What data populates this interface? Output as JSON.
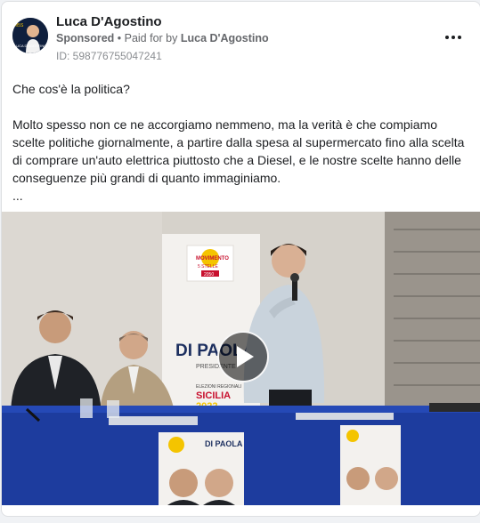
{
  "post": {
    "page_name": "Luca D'Agostino",
    "sponsored_label": "Sponsored",
    "paid_for_prefix": " • Paid for by ",
    "payer": "Luca D'Agostino",
    "library_id": "ID: 598776755047241",
    "text": {
      "line1": "Che cos'è la politica?",
      "paragraph": "Molto spesso non ce ne accorgiamo nemmeno, ma la verità è che compiamo scelte politiche giornalmente, a partire dalla spesa al supermercato fino alla scelta di comprare un'auto elettrica piuttosto che a Diesel, e le nostre scelte hanno delle conseguenze più grandi di quanto immaginiamo.",
      "ellipsis": "..."
    }
  },
  "avatar": {
    "logo_text": "M5S",
    "name_text": "LUCA D'AGOSTINO"
  },
  "video": {
    "banner_logo_line1": "MOVIMENTO",
    "banner_logo_line2": "5 STELLE",
    "banner_logo_year": "2050",
    "banner_name": "DI PAOLA",
    "banner_role": "PRESIDENTE",
    "banner_election": "ELEZIONI REGIONALI",
    "banner_region": "SICILIA",
    "banner_year": "2022",
    "poster_name": "DI PAOLA"
  },
  "icons": {
    "more": "more-horizontal-icon",
    "play": "play-icon"
  }
}
